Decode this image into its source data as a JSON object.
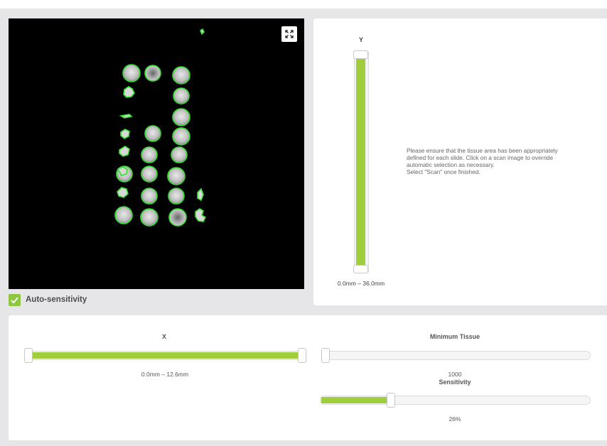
{
  "scan_view": {
    "expand_icon": "expand-icon",
    "accent_color": "#33e02e"
  },
  "auto_sensitivity": {
    "label": "Auto-sensitivity",
    "checked": true,
    "check_icon": "checkmark-icon",
    "color": "#8fc63f"
  },
  "y_axis": {
    "label": "Y",
    "range_text": "0.0mm – 36.0mm",
    "min_fraction": 0.0,
    "max_fraction": 1.0
  },
  "instructions": {
    "lines": [
      "Please ensure that the tissue area has been appropriately",
      "defined for each slide. Click on a scan image to override",
      "automatic selection as necessary.",
      "Select \"Scan\" once finished."
    ]
  },
  "x_axis": {
    "label": "X",
    "range_text": "0.0mm – 12.6mm",
    "min_fraction": 0.0,
    "max_fraction": 1.0
  },
  "minimum_tissue": {
    "label": "Minimum Tissue",
    "value": "1000",
    "fraction": 0.0
  },
  "sensitivity": {
    "label": "Sensitivity",
    "value": "26%",
    "fraction": 0.26
  },
  "colors": {
    "accent": "#9fcd3b",
    "background": "#e6e6e9"
  }
}
